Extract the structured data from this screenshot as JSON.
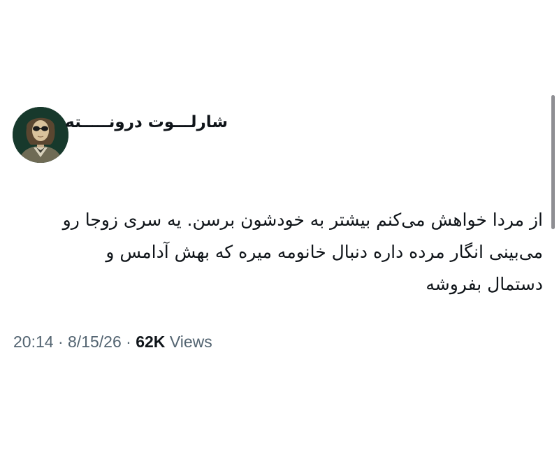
{
  "tweet": {
    "author": {
      "display_name": "شارلـــوت درونـــــته",
      "avatar_icon": "portrait-avatar-icon"
    },
    "text_lines": [
      "از مردا خواهش می‌کنم بیشتر به خودشون برسن. یه سری زوجا رو",
      "می‌بینی انگار مرده داره دنبال خانومه میره که بهش آدامس و",
      "دستمال بفروشه"
    ],
    "meta": {
      "time": "20:14",
      "separator": "·",
      "date": "8/15/26",
      "views_count": "62K",
      "views_label": "Views"
    }
  },
  "colors": {
    "text": "#0f1419",
    "secondary": "#536471",
    "avatar_background": "#17392c",
    "scrollbar": "#8e8e93"
  }
}
